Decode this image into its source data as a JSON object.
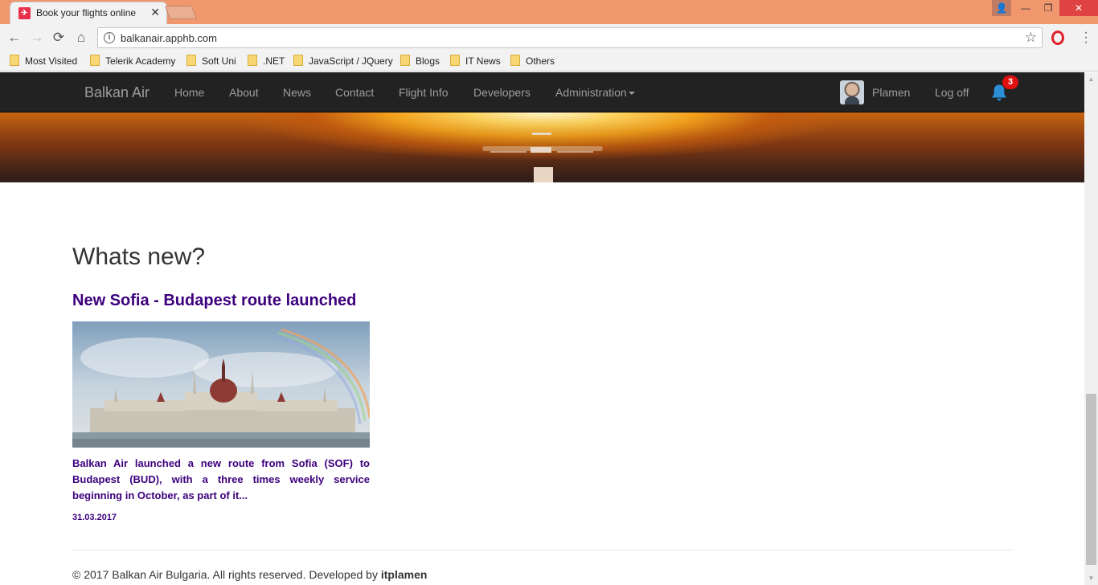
{
  "browser": {
    "tab_title": "Book your flights online",
    "tab_favicon": "balkan-air-favicon",
    "url": "balkanair.apphb.com",
    "bookmarks": [
      "Most Visited",
      "Telerik Academy",
      "Soft Uni",
      ".NET",
      "JavaScript / JQuery",
      "Blogs",
      "IT News",
      "Others"
    ],
    "icons": {
      "back": "←",
      "forward": "→",
      "reload": "⟳",
      "home": "⌂",
      "star": "☆",
      "info": "i",
      "close": "✕",
      "minimize": "—",
      "restore": "❐",
      "user": "👤",
      "menu": "⋮",
      "scroll_up": "▲",
      "scroll_down": "▼"
    }
  },
  "navbar": {
    "brand": "Balkan Air",
    "items": [
      "Home",
      "About",
      "News",
      "Contact",
      "Flight Info",
      "Developers",
      "Administration"
    ],
    "user_name": "Plamen",
    "logoff": "Log off",
    "notification_count": "3"
  },
  "main": {
    "heading": "Whats new?",
    "news": [
      {
        "title": "New Sofia - Budapest route launched",
        "summary": "Balkan Air launched a new route from Sofia (SOF) to Budapest (BUD), with a three times weekly service beginning in October, as part of it...",
        "date": "31.03.2017"
      }
    ]
  },
  "footer": {
    "text": "© 2017 Balkan Air Bulgaria. All rights reserved. Developed by ",
    "author": "itplamen"
  },
  "colors": {
    "titlebar": "#f0976d",
    "navbar": "#222222",
    "nav_text": "#9d9d9d",
    "news_link": "#3d007d",
    "badge": "#e01010",
    "bell": "#2a8fd6"
  }
}
